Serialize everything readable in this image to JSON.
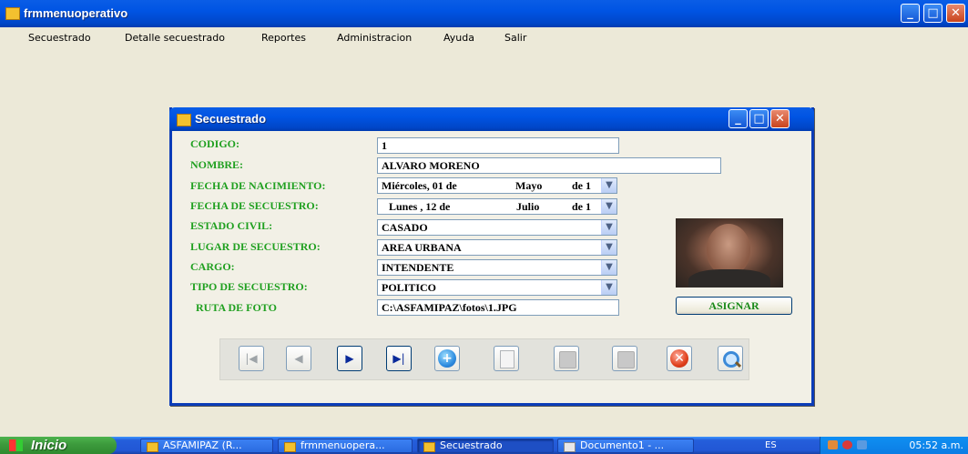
{
  "window": {
    "title": "frmmenuoperativo"
  },
  "menu": [
    "Secuestrado",
    "Detalle secuestrado",
    "Reportes",
    "Administracion",
    "Ayuda",
    "Salir"
  ],
  "dialog": {
    "title": "Secuestrado",
    "labels": {
      "codigo": "CODIGO:",
      "nombre": "NOMBRE:",
      "fecha_nacimiento": "FECHA DE NACIMIENTO:",
      "fecha_secuestro": "FECHA DE SECUESTRO:",
      "estado_civil": "ESTADO CIVIL:",
      "lugar_secuestro": "LUGAR DE SECUESTRO:",
      "cargo": "CARGO:",
      "tipo_secuestro": "TIPO DE SECUESTRO:",
      "ruta_foto": "RUTA DE FOTO"
    },
    "values": {
      "codigo": "1",
      "nombre": "ALVARO MORENO",
      "fecha_nacimiento": {
        "day": "Miércoles, 01 de",
        "month": "Mayo",
        "year": "de 1"
      },
      "fecha_secuestro": {
        "day": "Lunes  , 12 de",
        "month": "Julio",
        "year": "de 1"
      },
      "estado_civil": "CASADO",
      "lugar_secuestro": "AREA URBANA",
      "cargo": "INTENDENTE",
      "tipo_secuestro": "POLITICO",
      "ruta_foto": "C:\\ASFAMIPAZ\\fotos\\1.JPG"
    },
    "asignar_label": "ASIGNAR",
    "toolbar": [
      {
        "icon": "first-record-icon",
        "glyph": "|◀",
        "enabled": false
      },
      {
        "icon": "previous-record-icon",
        "glyph": "◀",
        "enabled": false
      },
      {
        "icon": "next-record-icon",
        "glyph": "▶",
        "enabled": true
      },
      {
        "icon": "last-record-icon",
        "glyph": "▶|",
        "enabled": true
      },
      {
        "icon": "add-icon",
        "glyph": "+",
        "enabled": true
      },
      {
        "icon": "edit-icon",
        "enabled": false
      },
      {
        "icon": "save-icon",
        "enabled": false
      },
      {
        "icon": "cancel-save-icon",
        "enabled": false
      },
      {
        "icon": "delete-icon",
        "glyph": "✕",
        "enabled": true
      },
      {
        "icon": "search-icon",
        "enabled": true
      }
    ]
  },
  "taskbar": {
    "start_label": "Inicio",
    "tasks": [
      "ASFAMIPAZ (R...",
      "frmmenuopera...",
      "Secuestrado",
      "Documento1 - ..."
    ],
    "active_task": "Secuestrado",
    "language": "ES",
    "clock": "05:52 a.m."
  },
  "colors": {
    "label_green": "#20a020",
    "xp_blue": "#0054e3",
    "taskbar_blue": "#245edb",
    "start_green": "#3c9a3c"
  }
}
